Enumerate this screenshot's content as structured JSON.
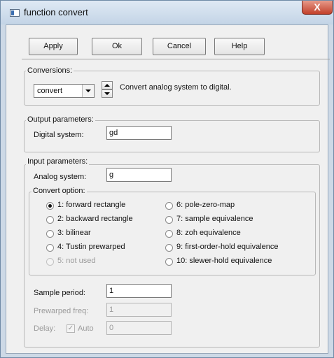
{
  "window": {
    "title": "function convert",
    "close_glyph": "X"
  },
  "toolbar": {
    "apply": "Apply",
    "ok": "Ok",
    "cancel": "Cancel",
    "help": "Help"
  },
  "conversions": {
    "legend": "Conversions:",
    "selected": "convert",
    "description": "Convert analog system to digital."
  },
  "output": {
    "legend": "Output parameters:",
    "digital_label": "Digital system:",
    "digital_value": "gd"
  },
  "input": {
    "legend": "Input parameters:",
    "analog_label": "Analog system:",
    "analog_value": "g",
    "convert_option": {
      "legend": "Convert option:",
      "selected_index": 0,
      "options_left": [
        {
          "label": "1: forward rectangle",
          "checked": true,
          "enabled": true
        },
        {
          "label": "2: backward rectangle",
          "checked": false,
          "enabled": true
        },
        {
          "label": "3: bilinear",
          "checked": false,
          "enabled": true
        },
        {
          "label": "4: Tustin prewarped",
          "checked": false,
          "enabled": true
        },
        {
          "label": "5: not used",
          "checked": false,
          "enabled": false
        }
      ],
      "options_right": [
        {
          "label": "6: pole-zero-map",
          "checked": false,
          "enabled": true
        },
        {
          "label": "7: sample equivalence",
          "checked": false,
          "enabled": true
        },
        {
          "label": "8: zoh equivalence",
          "checked": false,
          "enabled": true
        },
        {
          "label": "9: first-order-hold equivalence",
          "checked": false,
          "enabled": true
        },
        {
          "label": "10: slewer-hold equivalence",
          "checked": false,
          "enabled": true
        }
      ]
    },
    "sample_period_label": "Sample period:",
    "sample_period_value": "1",
    "prewarped_label": "Prewarped freq:",
    "prewarped_value": "1",
    "delay_label": "Delay:",
    "auto_label": "Auto",
    "auto_checked": true,
    "delay_value": "0"
  },
  "icons": {
    "app": "window-app-icon",
    "close": "close-icon",
    "combo": "chevron-down-icon",
    "spin_up": "spin-up-icon",
    "spin_down": "spin-down-icon"
  }
}
